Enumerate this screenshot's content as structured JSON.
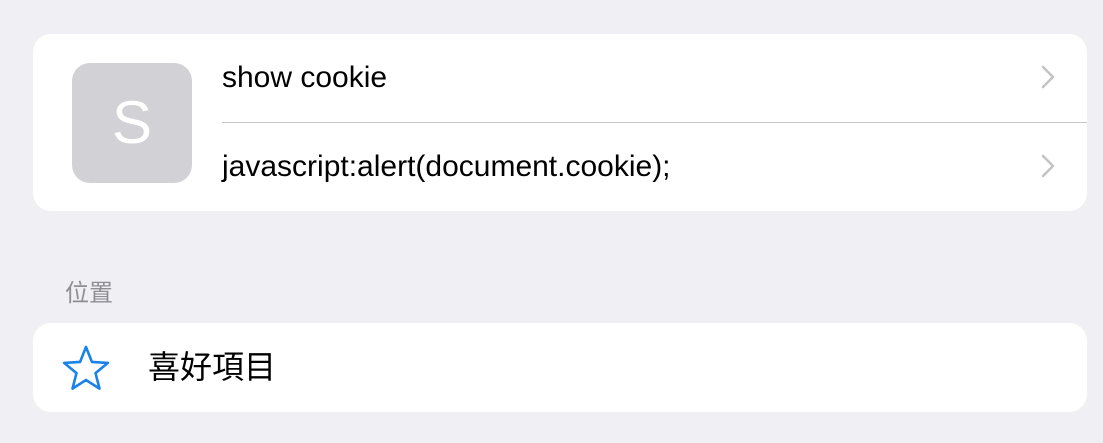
{
  "bookmark": {
    "avatar_letter": "S",
    "title": "show cookie",
    "url": "javascript:alert(document.cookie);"
  },
  "location_section": {
    "header": "位置",
    "item_label": "喜好項目",
    "item_icon": "star-icon"
  },
  "colors": {
    "background": "#efeff4",
    "card": "#ffffff",
    "avatar": "#d1d1d6",
    "accent": "#1a82e8",
    "secondary_text": "#8e8e93",
    "chevron": "#c4c4c7"
  }
}
